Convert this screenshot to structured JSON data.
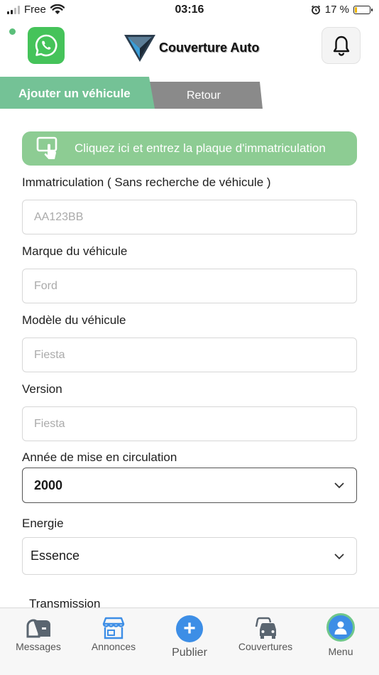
{
  "status_bar": {
    "carrier": "Free",
    "time": "03:16",
    "battery": "17 %",
    "battery_level": 0.17
  },
  "header": {
    "logo_text": "Couverture Auto",
    "whatsapp_icon": "whatsapp-icon",
    "bell_icon": "bell-icon"
  },
  "tabs": {
    "active": "Ajouter un véhicule",
    "back": "Retour"
  },
  "plate_button": {
    "label": "Cliquez ici et entrez la plaque d'immatriculation",
    "icon": "tap-icon"
  },
  "form": {
    "registration": {
      "label": "Immatriculation ( Sans recherche de véhicule )",
      "placeholder": "AA123BB"
    },
    "brand": {
      "label": "Marque du véhicule",
      "placeholder": "Ford"
    },
    "model": {
      "label": "Modèle du véhicule",
      "placeholder": "Fiesta"
    },
    "version": {
      "label": "Version",
      "placeholder": "Fiesta"
    },
    "year": {
      "label": "Année de mise en circulation",
      "value": "2000"
    },
    "energy": {
      "label": "Energie",
      "value": "Essence"
    },
    "transmission": {
      "label": "Transmission"
    }
  },
  "bottom_nav": {
    "messages": "Messages",
    "annonces": "Annonces",
    "publier": "Publier",
    "couvertures": "Couvertures",
    "menu": "Menu"
  },
  "colors": {
    "accent_green": "#74c296",
    "plate_green": "#8dcc93",
    "whatsapp_green": "#45c35a",
    "nav_blue": "#3d8ee6",
    "tab_gray": "#8a8a8a"
  }
}
